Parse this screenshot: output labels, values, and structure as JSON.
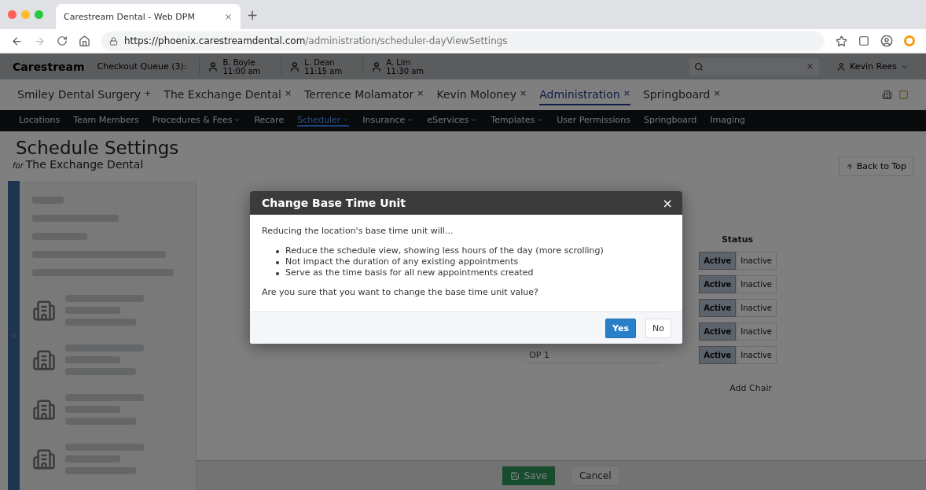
{
  "browser": {
    "tab_title": "Carestream Dental - Web DPM",
    "new_tab": "+",
    "url_host": "https://phoenix.carestreamdental.com",
    "url_path": "/administration/scheduler-dayViewSettings"
  },
  "header": {
    "logo": "Carestream",
    "queue": "Checkout Queue (3):",
    "queue_items": [
      {
        "name": "B. Boyle",
        "time": "11:00 am"
      },
      {
        "name": "L. Dean",
        "time": "11:15 am"
      },
      {
        "name": "A. Lim",
        "time": "11:30 am"
      }
    ],
    "user": "Kevin Rees"
  },
  "open_tabs": [
    {
      "label": "Smiley Dental Surgery",
      "mark": "+",
      "selected": false
    },
    {
      "label": "The Exchange Dental",
      "mark": "×",
      "selected": false
    },
    {
      "label": "Terrence Molamator",
      "mark": "×",
      "selected": false
    },
    {
      "label": "Kevin Moloney",
      "mark": "×",
      "selected": false
    },
    {
      "label": "Administration",
      "mark": "×",
      "selected": true
    },
    {
      "label": "Springboard",
      "mark": "×",
      "selected": false
    }
  ],
  "nav": [
    {
      "label": "Locations",
      "dropdown": false,
      "selected": false
    },
    {
      "label": "Team Members",
      "dropdown": false,
      "selected": false
    },
    {
      "label": "Procedures & Fees",
      "dropdown": true,
      "selected": false
    },
    {
      "label": "Recare",
      "dropdown": false,
      "selected": false
    },
    {
      "label": "Scheduler",
      "dropdown": true,
      "selected": true
    },
    {
      "label": "Insurance",
      "dropdown": true,
      "selected": false
    },
    {
      "label": "eServices",
      "dropdown": true,
      "selected": false
    },
    {
      "label": "Templates",
      "dropdown": true,
      "selected": false
    },
    {
      "label": "User Permissions",
      "dropdown": false,
      "selected": false
    },
    {
      "label": "Springboard",
      "dropdown": false,
      "selected": false
    },
    {
      "label": "Imaging",
      "dropdown": false,
      "selected": false
    }
  ],
  "page": {
    "title": "Schedule Settings",
    "for_label": "for",
    "location": "The Exchange Dental",
    "back_to_top": "Back to Top"
  },
  "chairs": {
    "status_header": "Status",
    "rows": [
      {
        "options": [
          {
            "label": "Active",
            "selected": true
          },
          {
            "label": "Inactive",
            "selected": false
          }
        ]
      },
      {
        "options": [
          {
            "label": "Active",
            "selected": true
          },
          {
            "label": "Inactive",
            "selected": false
          }
        ]
      },
      {
        "options": [
          {
            "label": "Active",
            "selected": true
          },
          {
            "label": "Inactive",
            "selected": false
          }
        ]
      },
      {
        "options": [
          {
            "label": "Active",
            "selected": true
          },
          {
            "label": "Inactive",
            "selected": false
          }
        ]
      },
      {
        "name": "OP 1",
        "options": [
          {
            "label": "Active",
            "selected": true
          },
          {
            "label": "Inactive",
            "selected": false
          }
        ]
      }
    ],
    "add": "Add Chair"
  },
  "footer": {
    "save": "Save",
    "cancel": "Cancel"
  },
  "dialog": {
    "title": "Change Base Time Unit",
    "close": "×",
    "intro": "Reducing the location's base time unit will...",
    "bullets": [
      "Reduce the schedule view, showing less hours of the day (more scrolling)",
      "Not impact the duration of any existing appointments",
      "Serve as the time basis for all new appointments created"
    ],
    "question": "Are you sure that you want to change the base time unit value?",
    "yes": "Yes",
    "no": "No"
  }
}
